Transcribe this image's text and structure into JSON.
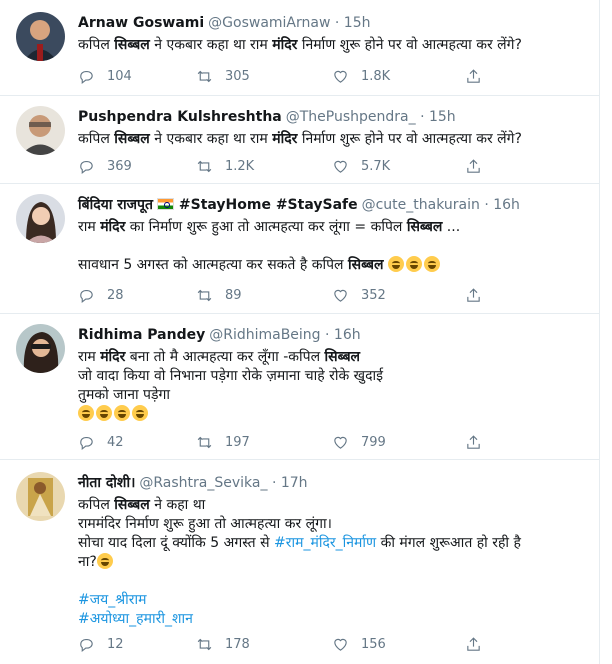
{
  "tweets": [
    {
      "name": "Arnaw Goswami",
      "handle": "@GoswamiArnaw",
      "time": "· 15h",
      "lines": [
        {
          "a": "कपिल ",
          "b": "सिब्बल",
          "c": " ने एकबार कहा था राम ",
          "d": "मंदिर",
          "e": " निर्माण शुरू होने पर वो आत्महत्या कर लेंगे?"
        }
      ],
      "reply": "104",
      "retweet": "305",
      "like": "1.8K"
    },
    {
      "name": "Pushpendra Kulshreshtha",
      "handle": "@ThePushpendra_",
      "time": "· 15h",
      "lines": [
        {
          "a": "कपिल ",
          "b": "सिब्बल",
          "c": " ने एकबार कहा था राम ",
          "d": "मंदिर",
          "e": " निर्माण शुरू होने पर वो आत्महत्या कर लेंगे?"
        }
      ],
      "reply": "369",
      "retweet": "1.2K",
      "like": "5.7K"
    },
    {
      "name_a": "बिंदिया राजपूत",
      "name_b": "#StayHome #StaySafe",
      "handle": "@cute_thakurain",
      "time": "· 16h",
      "line1": {
        "a": "राम ",
        "b": "मंदिर",
        "c": " का निर्माण शुरू हुआ तो आत्महत्या कर लूंगा = कपिल ",
        "d": "सिब्बल",
        "e": " ..."
      },
      "line2": {
        "a": "सावधान 5 अगस्त को आत्महत्या कर सकते है कपिल ",
        "b": "सिब्बल"
      },
      "reply": "28",
      "retweet": "89",
      "like": "352"
    },
    {
      "name": "Ridhima Pandey",
      "handle": "@RidhimaBeing",
      "time": "· 16h",
      "line1": {
        "a": "राम ",
        "b": "मंदिर",
        "c": " बना तो मै आत्महत्या कर लूँगा -कपिल ",
        "d": "सिब्बल"
      },
      "line2": "जो वादा किया वो निभाना पड़ेगा रोके ज़माना चाहे रोके खुदाई",
      "line3": "तुमको जाना पड़ेगा",
      "reply": "42",
      "retweet": "197",
      "like": "799"
    },
    {
      "name": "नीता दोशी।",
      "handle": "@Rashtra_Sevika_",
      "time": "· 17h",
      "line1": {
        "a": "कपिल ",
        "b": "सिब्बल",
        "c": " ने कहा था"
      },
      "line2": "राममंदिर निर्माण शुरू हुआ तो आत्महत्या कर लूंगा।",
      "line3": {
        "a": "सोचा याद दिला दूं क्योंकि 5 अगस्त से ",
        "b": "#राम_मंदिर_निर्माण",
        "c": " की मंगल शुरूआत हो रही है"
      },
      "line4": "ना?",
      "tag1": "#जय_श्रीराम",
      "tag2": "#अयोध्या_हमारी_शान",
      "reply": "12",
      "retweet": "178",
      "like": "156"
    }
  ],
  "icons": {
    "reply": "reply-icon",
    "retweet": "retweet-icon",
    "like": "like-icon",
    "share": "share-icon"
  },
  "colors": {
    "link": "#1b95e0",
    "muted": "#657786",
    "border": "#e6ecf0"
  }
}
